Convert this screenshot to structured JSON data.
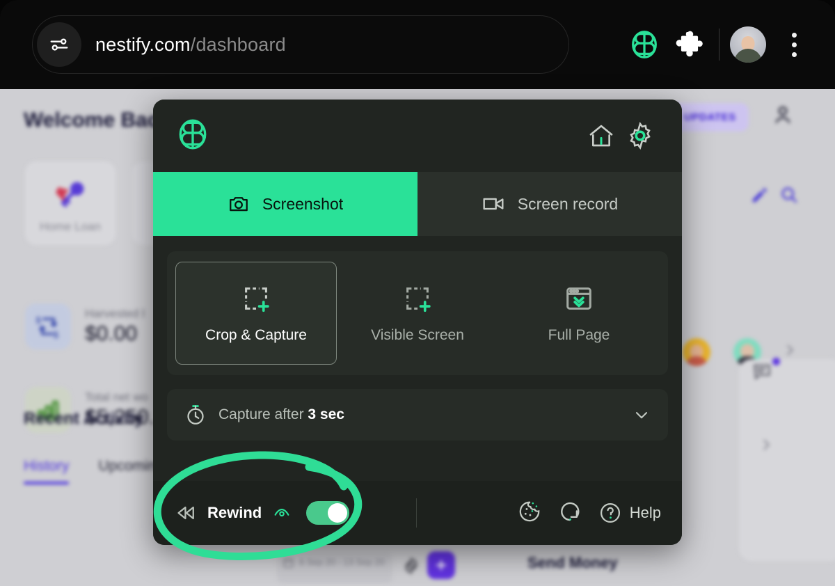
{
  "browser": {
    "url_host": "nestify.com",
    "url_path": "/dashboard",
    "tune_icon": "sliders-icon",
    "extension_logo_icon": "bb-logo-icon",
    "puzzle_icon": "puzzle-piece-icon",
    "avatar_icon": "user-avatar",
    "menu_icon": "kebab-menu-icon"
  },
  "page": {
    "welcome_title": "Welcome Back",
    "updates_badge": "UPDATES",
    "account_icon": "person-outline-icon",
    "tiles": [
      {
        "label": "Home Loan",
        "icon": "car-key-icon"
      }
    ],
    "stats": [
      {
        "label": "Harvested l",
        "value": "$0.00",
        "icon": "transfer-icon"
      },
      {
        "label": "Total net wo",
        "value": "$5,250.",
        "icon": "bar-chart-icon"
      }
    ],
    "recent_activity_title": "Recent Activity",
    "tabs": [
      {
        "label": "History",
        "active": true
      },
      {
        "label": "Upcoming",
        "active": false
      }
    ],
    "date_range": "6 Sep 20 - 13 Sep 20",
    "date_range_icon": "calendar-icon",
    "settings_icon": "gear-icon",
    "add_button_icon": "plus-icon",
    "send_money_title": "Send Money",
    "edit_icon": "pencil-icon",
    "search_icon": "search-icon",
    "chat_icon": "chat-bubble-icon",
    "chevron_icon": "chevron-right-icon"
  },
  "popup": {
    "logo_icon": "bb-logo-icon",
    "home_icon": "home-icon",
    "settings_icon": "gear-icon",
    "tabs": [
      {
        "label": "Screenshot",
        "icon": "camera-icon",
        "active": true
      },
      {
        "label": "Screen record",
        "icon": "video-camera-icon",
        "active": false
      }
    ],
    "modes": [
      {
        "label": "Crop & Capture",
        "icon": "crop-capture-icon",
        "active": true
      },
      {
        "label": "Visible Screen",
        "icon": "visible-screen-icon",
        "active": false
      },
      {
        "label": "Full Page",
        "icon": "full-page-icon",
        "active": false
      }
    ],
    "timer": {
      "prefix": "Capture after",
      "value": "3 sec",
      "icon": "stopwatch-icon",
      "chevron_icon": "chevron-down-icon"
    },
    "footer": {
      "rewind_label": "Rewind",
      "rewind_icon": "rewind-double-arrow-icon",
      "eye_icon": "eye-icon",
      "rewind_enabled": true,
      "cookie_icon": "cookie-icon",
      "reload_icon": "refresh-icon",
      "help_icon": "question-circle-icon",
      "help_label": "Help"
    }
  },
  "colors": {
    "accent_green": "#2ae198",
    "annotation_green": "#2fdd96",
    "panel_bg": "#212521",
    "footer_bg": "#1d211d",
    "brand_purple": "#5b34e0"
  }
}
